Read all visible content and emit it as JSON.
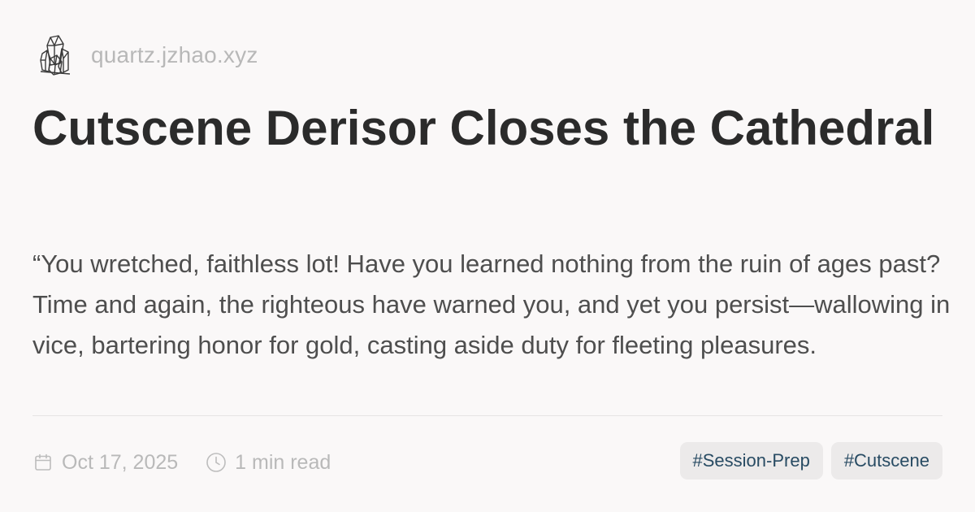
{
  "header": {
    "site": "quartz.jzhao.xyz",
    "logo_icon": "crystal-icon"
  },
  "title": "Cutscene Derisor Closes the Cathedral",
  "excerpt": "“You wretched, faithless lot! Have you learned nothing from the ruin of ages past? Time and again, the righteous have warned you, and yet you persist—wallowing in vice, bartering honor for gold, casting aside duty for fleeting pleasures.",
  "meta": {
    "date": "Oct 17, 2025",
    "date_icon": "calendar-icon",
    "reading_time": "1 min read",
    "reading_icon": "clock-icon"
  },
  "tags": [
    "#Session-Prep",
    "#Cutscene"
  ],
  "colors": {
    "background": "#faf8f8",
    "title": "#2b2b2b",
    "body": "#4e4e4e",
    "muted": "#b9b9b9",
    "tag_text": "#284b63",
    "tag_bg": "#eceaea"
  }
}
